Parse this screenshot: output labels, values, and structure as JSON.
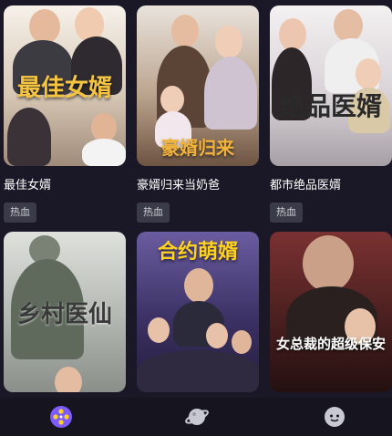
{
  "dramas": [
    {
      "name": "最佳女婿",
      "tag": "热血",
      "poster_title": "最佳女婿",
      "colors": [
        "#f3ede6",
        "#c9b7a4"
      ],
      "title_color": "#f5c542"
    },
    {
      "name": "豪婿归来当奶爸",
      "tag": "热血",
      "poster_title": "豪婿归来",
      "colors": [
        "#d9cfc4",
        "#8a6f5e"
      ],
      "title_color": "#f2b33a"
    },
    {
      "name": "都市绝品医婿",
      "tag": "热血",
      "poster_title": "绝品医婿",
      "colors": [
        "#f1eef0",
        "#b9b3bb"
      ],
      "title_color": "#2a2a2a"
    },
    {
      "name": "",
      "tag": "",
      "poster_title": "乡村医仙",
      "colors": [
        "#d8dad6",
        "#8f948f"
      ],
      "title_color": "#3a3a3a"
    },
    {
      "name": "",
      "tag": "",
      "poster_title": "合约萌婿",
      "colors": [
        "#5b4f86",
        "#2b2447"
      ],
      "title_color": "#ffd21f"
    },
    {
      "name": "",
      "tag": "",
      "poster_title": "女总裁的超级保安",
      "colors": [
        "#6e2b2b",
        "#2a1414"
      ],
      "title_color": "#ffffff"
    }
  ],
  "tabbar": {
    "active_color": "#7c5cff",
    "items": [
      {
        "icon": "film-reel-icon"
      },
      {
        "icon": "planet-icon"
      },
      {
        "icon": "profile-face-icon"
      }
    ]
  }
}
